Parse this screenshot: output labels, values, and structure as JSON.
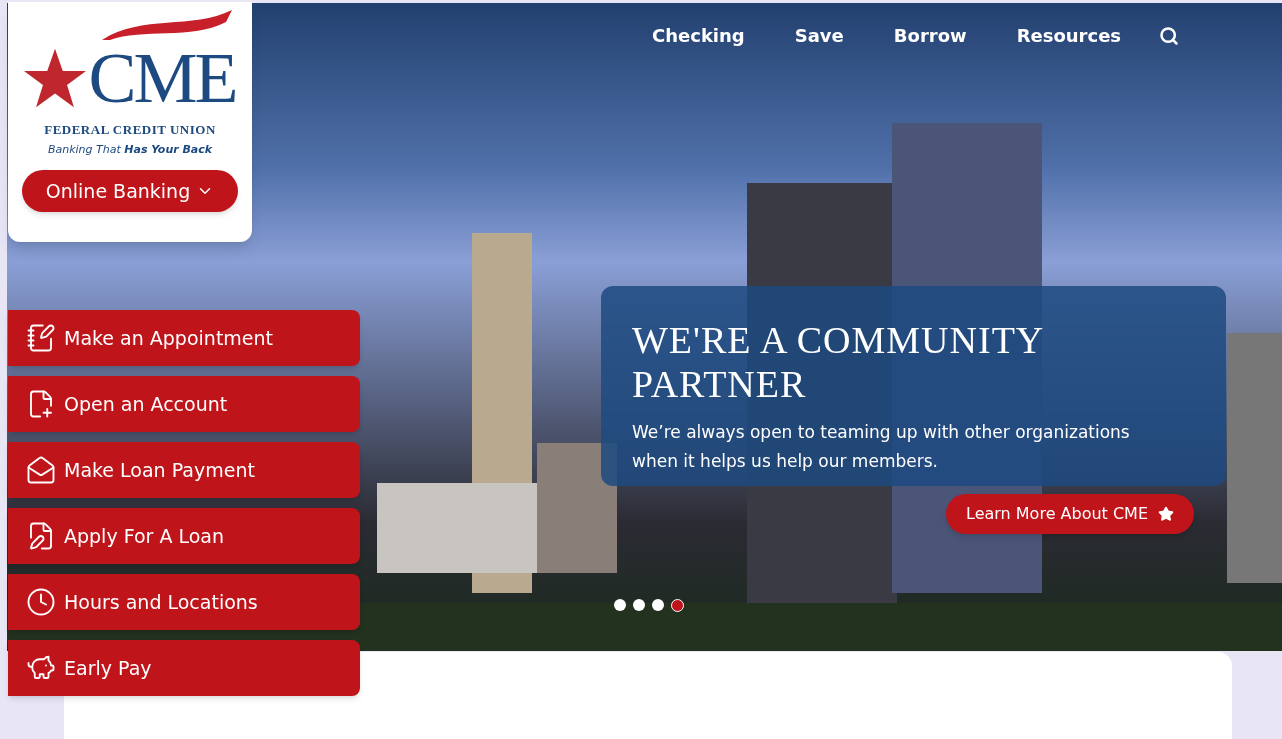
{
  "logo": {
    "wordmark": "CME",
    "subtitle": "FEDERAL CREDIT UNION",
    "tagline": "Banking That **Has Your Back**"
  },
  "online_banking": {
    "label": "Online Banking"
  },
  "nav": {
    "items": [
      {
        "label": "Checking"
      },
      {
        "label": "Save"
      },
      {
        "label": "Borrow"
      },
      {
        "label": "Resources"
      }
    ]
  },
  "quick_links": [
    {
      "label": "Make an Appointment"
    },
    {
      "label": "Open an Account"
    },
    {
      "label": "Make Loan Payment"
    },
    {
      "label": "Apply For A Loan"
    },
    {
      "label": "Hours and Locations"
    },
    {
      "label": "Early Pay"
    }
  ],
  "hero": {
    "title": "WE'RE A COMMUNITY PARTNER",
    "text": "We’re always open to teaming up with other organizations when it helps us help our members.",
    "button": "Learn More About CME"
  },
  "slides": [
    {
      "selected": false
    },
    {
      "selected": false
    },
    {
      "selected": false
    },
    {
      "selected": true
    }
  ]
}
